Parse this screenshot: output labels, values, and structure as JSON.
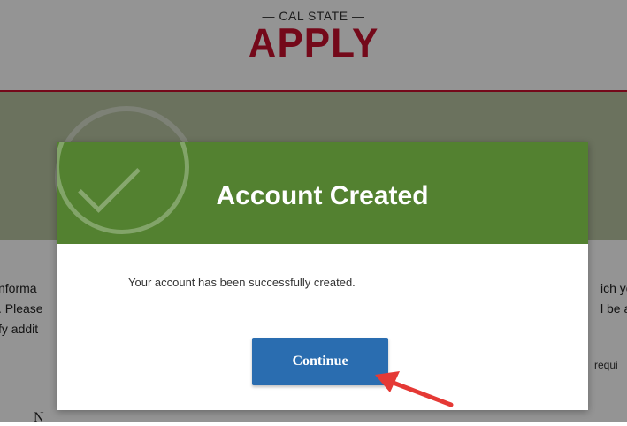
{
  "header": {
    "logo_small": "— CAL STATE —",
    "logo_big": "APPLY"
  },
  "background": {
    "left_lines": [
      "nforma",
      ". Please",
      "fy addit"
    ],
    "right_lines": [
      "ich yo",
      "l be a"
    ],
    "required_text": "requi",
    "name_label": "N"
  },
  "modal": {
    "title": "Account Created",
    "message": "Your account has been successfully created.",
    "continue_label": "Continue"
  },
  "colors": {
    "modal_header": "#538130",
    "button": "#2a6db0",
    "brand_red": "#c8102e",
    "arrow": "#e53935"
  },
  "icons": {
    "header_icon": "checkmark-circle-icon"
  }
}
